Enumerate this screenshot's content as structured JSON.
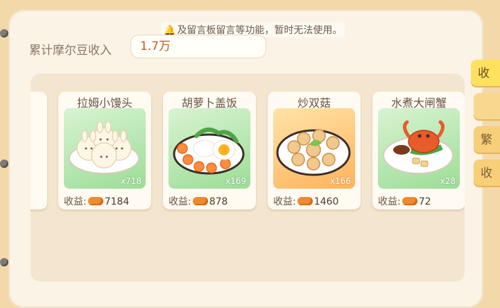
{
  "notice": {
    "text": "及留言板留言等功能，暂时无法使用。",
    "bell_icon": "bell-icon"
  },
  "income": {
    "label": "累计摩尔豆收入",
    "value": "1.7万"
  },
  "dishes": [
    {
      "name": "拉姆小馒头",
      "count": "x718",
      "earn_label": "收益:",
      "earn_value": "7184",
      "image": "steamed-bun-icon"
    },
    {
      "name": "胡萝卜盖饭",
      "count": "x169",
      "earn_label": "收益:",
      "earn_value": "878",
      "image": "carrot-rice-icon"
    },
    {
      "name": "炒双菇",
      "count": "x166",
      "earn_label": "收益:",
      "earn_value": "1460",
      "image": "fried-mushroom-icon"
    },
    {
      "name": "水煮大闸蟹",
      "count": "x28",
      "earn_label": "收益:",
      "earn_value": "72",
      "image": "boiled-crab-icon"
    }
  ],
  "tabs": [
    "收",
    "",
    "繁",
    "收"
  ],
  "colors": {
    "accent": "#ffe160",
    "income_text": "#c45a26",
    "bean": "#f08a2e"
  }
}
